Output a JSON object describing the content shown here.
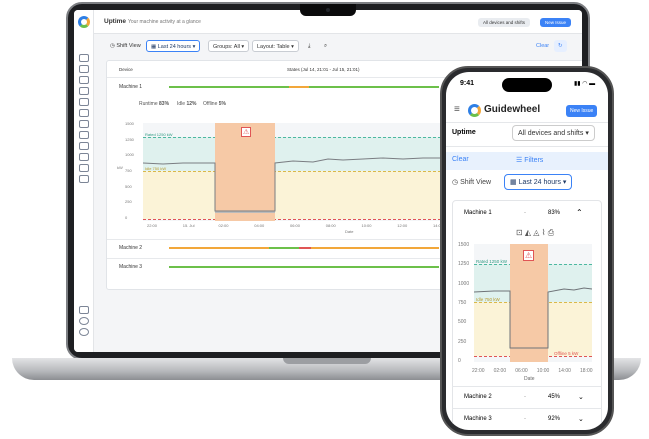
{
  "laptop": {
    "app_title": "Uptime",
    "app_subtitle": "Your machine activity at a glance",
    "devices_filter": "All devices and shifts",
    "new_issue": "New Issue",
    "toolbar": {
      "shift_view": "Shift View",
      "time_range": "Last 24 hours",
      "groups": "Groups: All",
      "layout": "Layout: Table",
      "clear": "Clear"
    },
    "table": {
      "col_device": "Device",
      "col_states": "States (Jul 14, 21:01 - Jul 15, 21:01)"
    },
    "machines": [
      {
        "name": "Machine 1"
      },
      {
        "name": "Machine 2"
      },
      {
        "name": "Machine 3"
      }
    ],
    "stats": {
      "runtime_label": "Runtime",
      "runtime_value": "83%",
      "idle_label": "Idle",
      "idle_value": "12%",
      "offline_label": "Offline",
      "offline_value": "5%"
    },
    "chart": {
      "ylabel": "kW",
      "xlabel": "Date",
      "rated_label": "Rated 1250 kW",
      "idle_label": "Idle 750 kW",
      "yticks": [
        "1500",
        "1250",
        "1000",
        "750",
        "500",
        "250",
        "0"
      ],
      "xticks": [
        "22:00",
        "15. Jul",
        "02:00",
        "04:00",
        "06:00",
        "08:00",
        "10:00",
        "12:00",
        "14:00"
      ]
    }
  },
  "phone": {
    "time": "9:41",
    "brand": "Guidewheel",
    "new_issue": "New Issue",
    "section": "Uptime",
    "devices_filter": "All devices and shifts",
    "clear": "Clear",
    "filters": "Filters",
    "shift_view": "Shift View",
    "time_range": "Last 24 hours",
    "machines": [
      {
        "name": "Machine 1",
        "dash": "-",
        "pct": "83%"
      },
      {
        "name": "Machine 2",
        "dash": "-",
        "pct": "45%"
      },
      {
        "name": "Machine 3",
        "dash": "-",
        "pct": "92%"
      }
    ],
    "chart": {
      "xlabel": "Date",
      "rated_label": "Rated 1250 kW",
      "idle_label": "Idle 750 kW",
      "offline_label": "Offline 5 kW",
      "yticks": [
        "1500",
        "1250",
        "1000",
        "750",
        "500",
        "250",
        "0"
      ],
      "xticks": [
        "22:00",
        "02:00",
        "06:00",
        "10:00",
        "14:00",
        "18:00"
      ]
    }
  },
  "colors": {
    "accent": "#3b82f6",
    "green": "#6cc04a",
    "orange": "#f2a73a",
    "red": "#e05555",
    "rated_band": "#dff1ee",
    "idle_band": "#fbf3d7",
    "alert_block": "#f6c9a6"
  }
}
